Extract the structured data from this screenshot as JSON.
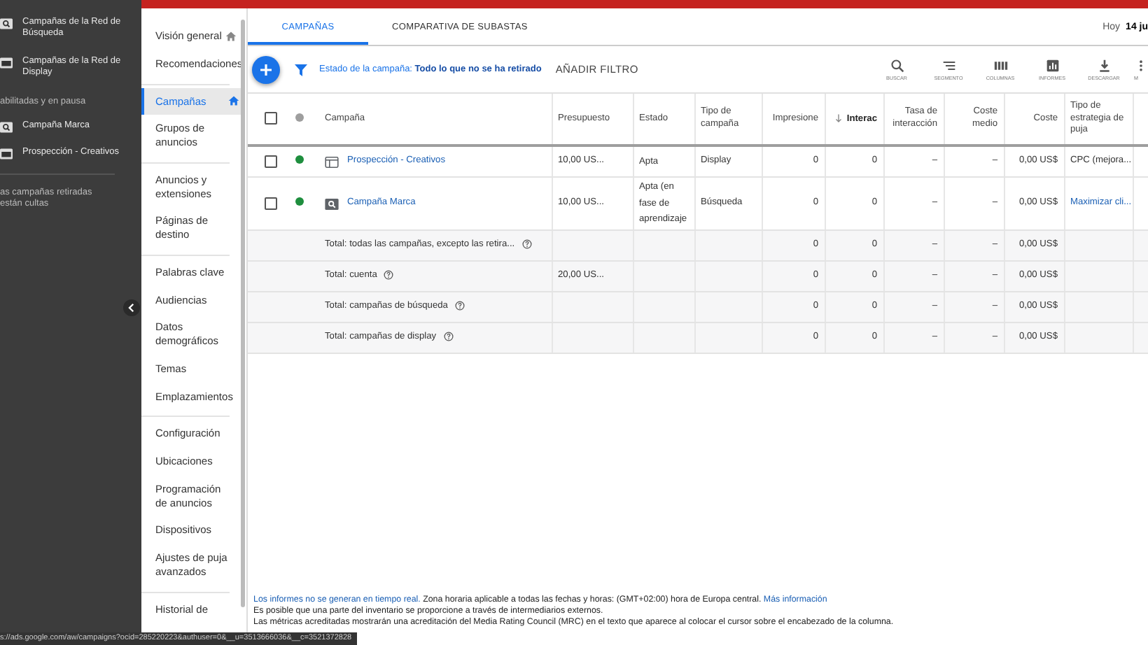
{
  "account_panel": {
    "items": [
      {
        "kind": "search",
        "label": "Campañas de la Red de Búsqueda"
      },
      {
        "kind": "display",
        "label": "Campañas de la Red de Display"
      },
      {
        "kind": "section",
        "label": "abilitadas y en pausa"
      },
      {
        "kind": "search",
        "label": "Campaña Marca"
      },
      {
        "kind": "display",
        "label": "Prospección - Creativos"
      },
      {
        "kind": "note",
        "label": "as campañas retiradas están cultas"
      }
    ]
  },
  "nav": {
    "groups": [
      [
        {
          "label": "Visión general",
          "home": true,
          "selected": false
        },
        {
          "label": "Recomendaciones",
          "home": false,
          "selected": false
        }
      ],
      [
        {
          "label": "Campañas",
          "home": true,
          "selected": true
        },
        {
          "label": "Grupos de anuncios",
          "home": false,
          "selected": false
        }
      ],
      [
        {
          "label": "Anuncios y extensiones",
          "home": false,
          "selected": false
        },
        {
          "label": "Páginas de destino",
          "home": false,
          "selected": false
        }
      ],
      [
        {
          "label": "Palabras clave",
          "home": false,
          "selected": false
        },
        {
          "label": "Audiencias",
          "home": false,
          "selected": false
        },
        {
          "label": "Datos demográficos",
          "home": false,
          "selected": false
        },
        {
          "label": "Temas",
          "home": false,
          "selected": false
        },
        {
          "label": "Emplazamientos",
          "home": false,
          "selected": false
        }
      ],
      [
        {
          "label": "Configuración",
          "home": false,
          "selected": false
        },
        {
          "label": "Ubicaciones",
          "home": false,
          "selected": false
        },
        {
          "label": "Programación de anuncios",
          "home": false,
          "selected": false
        },
        {
          "label": "Dispositivos",
          "home": false,
          "selected": false
        },
        {
          "label": "Ajustes de puja avanzados",
          "home": false,
          "selected": false
        }
      ],
      [
        {
          "label": "Historial de",
          "home": false,
          "selected": false
        }
      ]
    ]
  },
  "tabs": [
    {
      "label": "CAMPAÑAS",
      "selected": true
    },
    {
      "label": "COMPARATIVA DE SUBASTAS",
      "selected": false
    }
  ],
  "date": {
    "label": "Hoy",
    "value": "14 ju"
  },
  "filter": {
    "label": "Estado de la campaña:",
    "value": "Todo lo que no se ha retirado",
    "add": "AÑADIR FILTRO"
  },
  "toolbar": [
    "BUSCAR",
    "SEGMENTO",
    "COLUMNAS",
    "INFORMES",
    "DESCARGAR",
    "M"
  ],
  "table": {
    "select_all_checked": false,
    "columns": [
      {
        "label": "Campaña",
        "sorted": false
      },
      {
        "label": "Presupuesto",
        "sorted": false
      },
      {
        "label": "Estado",
        "sorted": false
      },
      {
        "label": "Tipo de campaña",
        "sorted": false
      },
      {
        "label": "Impresione",
        "sorted": false
      },
      {
        "label": "Interac",
        "sorted": true
      },
      {
        "label": "Tasa de interacción",
        "sorted": false
      },
      {
        "label": "Coste medio",
        "sorted": false
      },
      {
        "label": "Coste",
        "sorted": false
      },
      {
        "label": "Tipo de estrategia de puja",
        "sorted": false
      }
    ],
    "rows": [
      {
        "kind": "display",
        "checked": false,
        "color": "#1e8e3e",
        "cells": [
          "Prospección - Creativos",
          "10,00 US...",
          "Apta",
          "Display",
          "0",
          "0",
          "–",
          "–",
          "0,00 US$",
          "CPC (mejora..."
        ],
        "strategy_link": false
      },
      {
        "kind": "search",
        "checked": false,
        "color": "#1e8e3e",
        "cells": [
          "Campaña Marca",
          "10,00 US...",
          "Apta (en fase de aprendizaje",
          "Búsqueda",
          "0",
          "0",
          "–",
          "–",
          "0,00 US$",
          "Maximizar cli..."
        ],
        "strategy_link": true
      },
      {
        "kind": "total",
        "cells": [
          "Total: todas las campañas, excepto las retira...",
          "",
          "",
          "",
          "0",
          "0",
          "–",
          "–",
          "0,00 US$",
          ""
        ]
      },
      {
        "kind": "total",
        "cells": [
          "Total: cuenta",
          "20,00 US...",
          "",
          "",
          "0",
          "0",
          "–",
          "–",
          "0,00 US$",
          ""
        ]
      },
      {
        "kind": "total",
        "cells": [
          "Total: campañas de búsqueda",
          "",
          "",
          "",
          "0",
          "0",
          "–",
          "–",
          "0,00 US$",
          ""
        ]
      },
      {
        "kind": "total",
        "cells": [
          "Total: campañas de display",
          "",
          "",
          "",
          "0",
          "0",
          "–",
          "–",
          "0,00 US$",
          ""
        ]
      }
    ]
  },
  "footer": {
    "link1": "Los informes no se generan en tiempo real.",
    "text1": " Zona horaria aplicable a todas las fechas y horas: (GMT+02:00) hora de Europa central. ",
    "link2": "Más información",
    "line2": "Es posible que una parte del inventario se proporcione a través de intermediarios externos.",
    "line3": "Las métricas acreditadas mostrarán una acreditación del Media Rating Council (MRC) en el texto que aparece al colocar el cursor sobre el encabezado de la columna."
  },
  "status_url": "s://ads.google.com/aw/campaigns?ocid=285220223&authuser=0&__u=3513666036&__c=3521372828"
}
